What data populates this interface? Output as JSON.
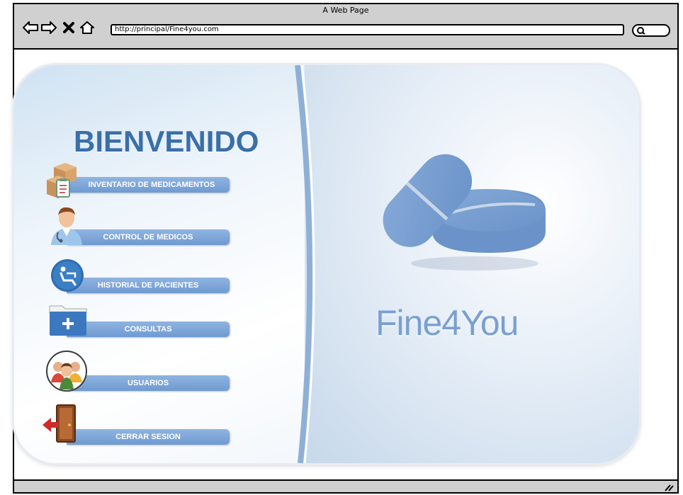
{
  "browser": {
    "title": "A Web Page",
    "url": "http://principal/Fine4you.com"
  },
  "sidebar": {
    "welcome": "BIENVENIDO",
    "items": [
      {
        "label": "INVENTARIO DE MEDICAMENTOS",
        "icon": "medicine-box-icon"
      },
      {
        "label": "CONTROL DE MEDICOS",
        "icon": "doctor-icon"
      },
      {
        "label": "HISTORIAL DE PACIENTES",
        "icon": "patient-history-icon"
      },
      {
        "label": "CONSULTAS",
        "icon": "folder-plus-icon"
      },
      {
        "label": "USUARIOS",
        "icon": "users-icon"
      },
      {
        "label": "CERRAR SESION",
        "icon": "exit-door-icon"
      }
    ]
  },
  "main": {
    "brand": "Fine4You"
  },
  "colors": {
    "accent": "#6f9ad1",
    "brand": "#7aa0d2",
    "title": "#3a6fa9"
  }
}
